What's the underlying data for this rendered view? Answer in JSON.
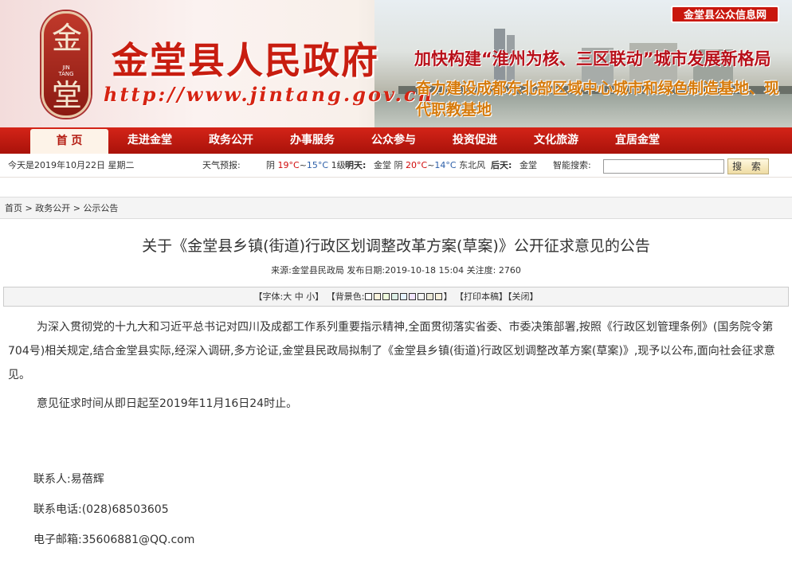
{
  "header": {
    "seal_char_top": "金",
    "seal_char_bottom": "堂",
    "seal_en_1": "JIN",
    "seal_en_2": "TANG",
    "site_title": "金堂县人民政府",
    "site_url": "http://www.jintang.gov.cn",
    "slogan_1": "加快构建“淮州为核、三区联动”城市发展新格局",
    "slogan_2": "奋力建设成都东北部区域中心城市和绿色制造基地、现代职教基地",
    "public_net_label": "金堂县公众信息网"
  },
  "nav": {
    "items": [
      "首 页",
      "走进金堂",
      "政务公开",
      "办事服务",
      "公众参与",
      "投资促进",
      "文化旅游",
      "宜居金堂"
    ]
  },
  "infobar": {
    "date": "今天是2019年10月22日 星期二",
    "weather_label": "天气预报:",
    "today_cond": "阴",
    "today_high": "19°C",
    "today_tilde": "~",
    "today_low": "15°C",
    "today_wind": "1级",
    "tomorrow_label": "明天:",
    "tomorrow_place": "金堂 阴",
    "tomorrow_high": "20°C",
    "tomorrow_low": "14°C",
    "tomorrow_wind": "东北风",
    "after_label": "后天:",
    "after_place": "金堂",
    "search_label": "智能搜索:",
    "search_value": "",
    "search_button": "搜 索"
  },
  "breadcrumb": "首页 > 政务公开 > 公示公告",
  "article": {
    "title": "关于《金堂县乡镇(街道)行政区划调整改革方案(草案)》公开征求意见的公告",
    "meta": "来源:金堂县民政局 发布日期:2019-10-18 15:04 关注度: 2760",
    "toolbar_font": "【字体:大 中 小】",
    "toolbar_bg": "【背景色:",
    "toolbar_bg_end": "】",
    "toolbar_print": "【打印本稿】",
    "toolbar_close": "【关闭】",
    "bg_swatches": [
      "#ffffff",
      "#faf3dc",
      "#eefadc",
      "#dcefe6",
      "#e4f2ff",
      "#f1e4ff",
      "#f5f5f5",
      "#ece9d8",
      "#f8f0dc"
    ],
    "para_1": "为深入贯彻党的十九大和习近平总书记对四川及成都工作系列重要指示精神,全面贯彻落实省委、市委决策部署,按照《行政区划管理条例》(国务院令第704号)相关规定,结合金堂县实际,经深入调研,多方论证,金堂县民政局拟制了《金堂县乡镇(街道)行政区划调整改革方案(草案)》,现予以公布,面向社会征求意见。",
    "para_2": "意见征求时间从即日起至2019年11月16日24时止。",
    "contact_person": "联系人:易蓓辉",
    "contact_phone": "联系电话:(028)68503605",
    "contact_email": "电子邮箱:35606881@QQ.com"
  }
}
